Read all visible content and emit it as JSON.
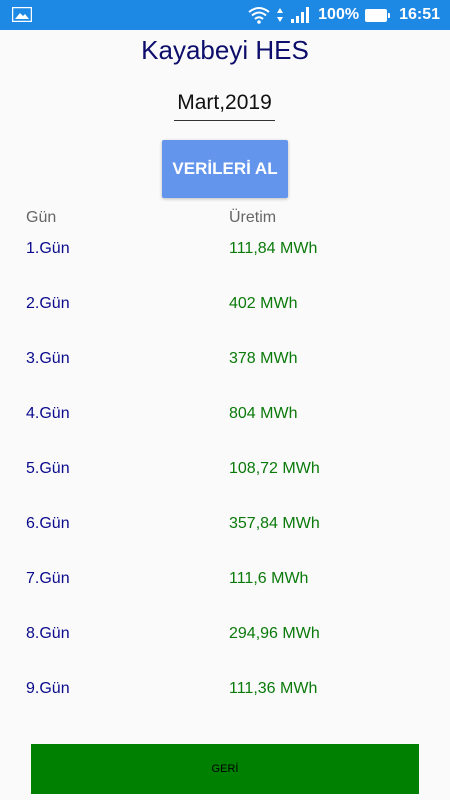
{
  "status_bar": {
    "battery_percent": "100%",
    "time": "16:51",
    "icons": [
      "image-notification-icon",
      "wifi-icon",
      "signal-icon",
      "battery-icon"
    ]
  },
  "header": {
    "title": "Kayabeyi HES",
    "date_value": "Mart,2019"
  },
  "fetch_button": {
    "label": "VERİLERİ AL",
    "color": "#6495ed"
  },
  "columns": {
    "day": "Gün",
    "production": "Üretim"
  },
  "rows": [
    {
      "day": "1.Gün",
      "value": "111,84 MWh"
    },
    {
      "day": "2.Gün",
      "value": "402 MWh"
    },
    {
      "day": "3.Gün",
      "value": "378 MWh"
    },
    {
      "day": "4.Gün",
      "value": "804 MWh"
    },
    {
      "day": "5.Gün",
      "value": "108,72 MWh"
    },
    {
      "day": "6.Gün",
      "value": "357,84 MWh"
    },
    {
      "day": "7.Gün",
      "value": "111,6 MWh"
    },
    {
      "day": "8.Gün",
      "value": "294,96 MWh"
    },
    {
      "day": "9.Gün",
      "value": "111,36 MWh"
    }
  ],
  "back_button": {
    "label": "GERİ",
    "color": "#008000"
  }
}
